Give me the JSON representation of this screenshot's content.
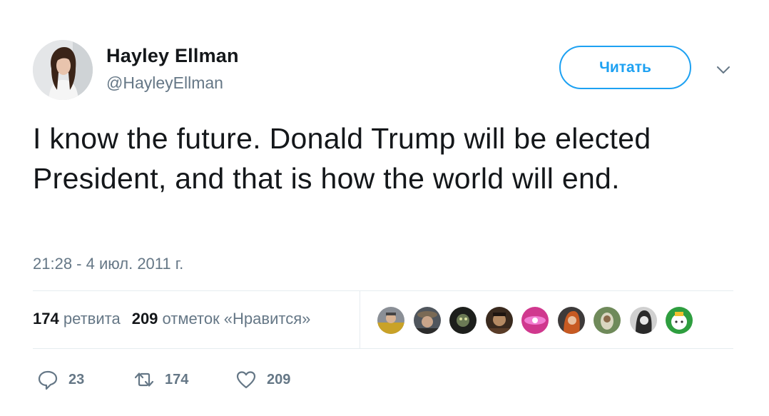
{
  "user": {
    "name": "Hayley Ellman",
    "handle": "@HayleyEllman"
  },
  "follow_label": "Читать",
  "tweet": {
    "text": "I know the future. Donald Trump will be elected President, and that is how the world will end.",
    "timestamp": "21:28 - 4 июл. 2011 г."
  },
  "stats": {
    "retweets_count": "174",
    "retweets_label": "ретвита",
    "likes_count": "209",
    "likes_label": "отметок «Нравится»"
  },
  "actions": {
    "reply_count": "23",
    "retweet_count": "174",
    "like_count": "209"
  },
  "colors": {
    "accent": "#1da1f2",
    "secondary_text": "#657786",
    "primary_text": "#14171a",
    "divider": "#e6ecf0"
  },
  "icons": {
    "caret": "chevron-down-icon",
    "reply": "reply-icon",
    "retweet": "retweet-icon",
    "like": "heart-icon"
  }
}
